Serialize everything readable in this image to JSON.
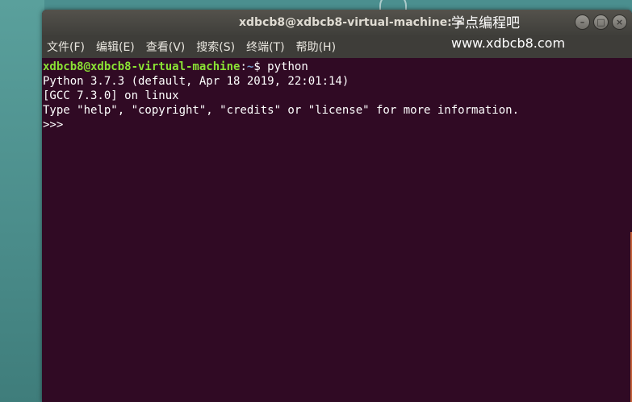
{
  "window": {
    "title": "xdbcb8@xdbcb8-virtual-machine: ~",
    "controls": {
      "minimize": "–",
      "maximize": "□",
      "close": "×"
    }
  },
  "menu": [
    "文件(F)",
    "编辑(E)",
    "查看(V)",
    "搜索(S)",
    "终端(T)",
    "帮助(H)"
  ],
  "terminal": {
    "prompt_user": "xdbcb8@xdbcb8-virtual-machine",
    "prompt_sep": ":",
    "prompt_path": "~",
    "prompt_command": "$ python",
    "lines": [
      "Python 3.7.3 (default, Apr 18 2019, 22:01:14)",
      "[GCC 7.3.0] on linux",
      "Type \"help\", \"copyright\", \"credits\" or \"license\" for more information.",
      ">>> "
    ]
  },
  "watermark": {
    "title": "学点编程吧",
    "url": "www.xdbcb8.com"
  },
  "colors": {
    "terminal_bg": "#300a24",
    "prompt_user": "#8ae234",
    "prompt_path": "#729fcf",
    "titlebar": "#3f3e3a"
  }
}
